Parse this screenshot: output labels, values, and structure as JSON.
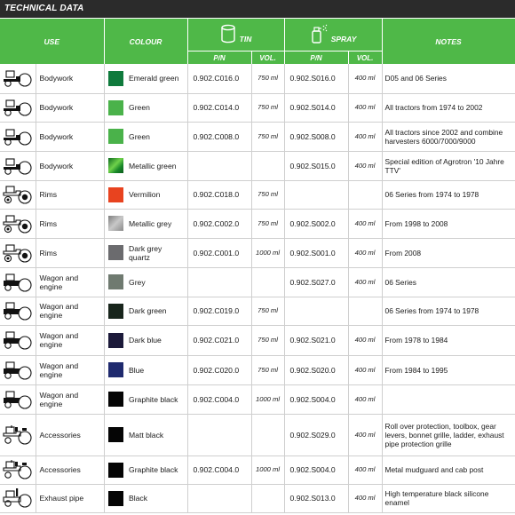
{
  "header_title": "TECHNICAL DATA",
  "columns": {
    "use": "USE",
    "colour": "COLOUR",
    "tin": "TIN",
    "spray": "SPRAY",
    "notes": "NOTES",
    "tin_pn": "P/N",
    "tin_vol": "VOL.",
    "spray_pn": "P/N",
    "spray_vol": "VOL."
  },
  "rows": [
    {
      "icon": "tractor-bodywork-icon",
      "use": "Bodywork",
      "colour": "Emerald green",
      "swatch": "#0f7a3c",
      "tin_pn": "0.902.C016.0",
      "tin_vol": "750 ml",
      "spray_pn": "0.902.S016.0",
      "spray_vol": "400 ml",
      "notes": "D05 and 06 Series"
    },
    {
      "icon": "tractor-bodywork-icon",
      "use": "Bodywork",
      "colour": "Green",
      "swatch": "#4ab24a",
      "tin_pn": "0.902.C014.0",
      "tin_vol": "750 ml",
      "spray_pn": "0.902.S014.0",
      "spray_vol": "400 ml",
      "notes": "All tractors from 1974 to 2002"
    },
    {
      "icon": "tractor-bodywork-icon",
      "use": "Bodywork",
      "colour": "Green",
      "swatch": "#4ab24a",
      "tin_pn": "0.902.C008.0",
      "tin_vol": "750 ml",
      "spray_pn": "0.902.S008.0",
      "spray_vol": "400 ml",
      "notes": "All tractors since 2002 and combine harvesters 6000/7000/9000"
    },
    {
      "icon": "tractor-bodywork-icon",
      "use": "Bodywork",
      "colour": "Metallic green",
      "swatch": "#2f9a30",
      "tin_pn": "",
      "tin_vol": "",
      "spray_pn": "0.902.S015.0",
      "spray_vol": "400 ml",
      "notes": "Special edition of Agrotron '10 Jahre TTV'"
    },
    {
      "icon": "tractor-rims-icon",
      "use": "Rims",
      "colour": "Vermilion",
      "swatch": "#e8431f",
      "tin_pn": "0.902.C018.0",
      "tin_vol": "750 ml",
      "spray_pn": "",
      "spray_vol": "",
      "notes": "06 Series from 1974 to 1978"
    },
    {
      "icon": "tractor-rims-icon",
      "use": "Rims",
      "colour": "Metallic grey",
      "swatch": "#9a9a9a",
      "tin_pn": "0.902.C002.0",
      "tin_vol": "750 ml",
      "spray_pn": "0.902.S002.0",
      "spray_vol": "400 ml",
      "notes": "From 1998 to 2008"
    },
    {
      "icon": "tractor-rims-icon",
      "use": "Rims",
      "colour": "Dark grey quartz",
      "swatch": "#6b6b6e",
      "tin_pn": "0.902.C001.0",
      "tin_vol": "1000 ml",
      "spray_pn": "0.902.S001.0",
      "spray_vol": "400 ml",
      "notes": "From 2008"
    },
    {
      "icon": "tractor-wagon-icon",
      "use": "Wagon and engine",
      "colour": "Grey",
      "swatch": "#6f7a70",
      "tin_pn": "",
      "tin_vol": "",
      "spray_pn": "0.902.S027.0",
      "spray_vol": "400 ml",
      "notes": "06 Series"
    },
    {
      "icon": "tractor-wagon-icon",
      "use": "Wagon and engine",
      "colour": "Dark green",
      "swatch": "#18251c",
      "tin_pn": "0.902.C019.0",
      "tin_vol": "750 ml",
      "spray_pn": "",
      "spray_vol": "",
      "notes": "06 Series from 1974 to 1978"
    },
    {
      "icon": "tractor-wagon-icon",
      "use": "Wagon and engine",
      "colour": "Dark blue",
      "swatch": "#1c1a3a",
      "tin_pn": "0.902.C021.0",
      "tin_vol": "750 ml",
      "spray_pn": "0.902.S021.0",
      "spray_vol": "400 ml",
      "notes": "From 1978 to 1984"
    },
    {
      "icon": "tractor-wagon-icon",
      "use": "Wagon and engine",
      "colour": "Blue",
      "swatch": "#1f2a6e",
      "tin_pn": "0.902.C020.0",
      "tin_vol": "750 ml",
      "spray_pn": "0.902.S020.0",
      "spray_vol": "400 ml",
      "notes": "From 1984 to 1995"
    },
    {
      "icon": "tractor-wagon-icon",
      "use": "Wagon and engine",
      "colour": "Graphite black",
      "swatch": "#050505",
      "tin_pn": "0.902.C004.0",
      "tin_vol": "1000 ml",
      "spray_pn": "0.902.S004.0",
      "spray_vol": "400 ml",
      "notes": ""
    },
    {
      "icon": "tractor-accessories-icon",
      "use": "Accessories",
      "colour": "Matt black",
      "swatch": "#050505",
      "tin_pn": "",
      "tin_vol": "",
      "spray_pn": "0.902.S029.0",
      "spray_vol": "400 ml",
      "notes": "Roll over protection, toolbox, gear levers, bonnet grille, ladder, exhaust pipe protection grille"
    },
    {
      "icon": "tractor-accessories-icon",
      "use": "Accessories",
      "colour": "Graphite black",
      "swatch": "#050505",
      "tin_pn": "0.902.C004.0",
      "tin_vol": "1000 ml",
      "spray_pn": "0.902.S004.0",
      "spray_vol": "400 ml",
      "notes": "Metal mudguard and cab post"
    },
    {
      "icon": "tractor-exhaust-icon",
      "use": "Exhaust pipe",
      "colour": "Black",
      "swatch": "#050505",
      "tin_pn": "",
      "tin_vol": "",
      "spray_pn": "0.902.S013.0",
      "spray_vol": "400 ml",
      "notes": "High temperature black silicone enamel"
    }
  ]
}
